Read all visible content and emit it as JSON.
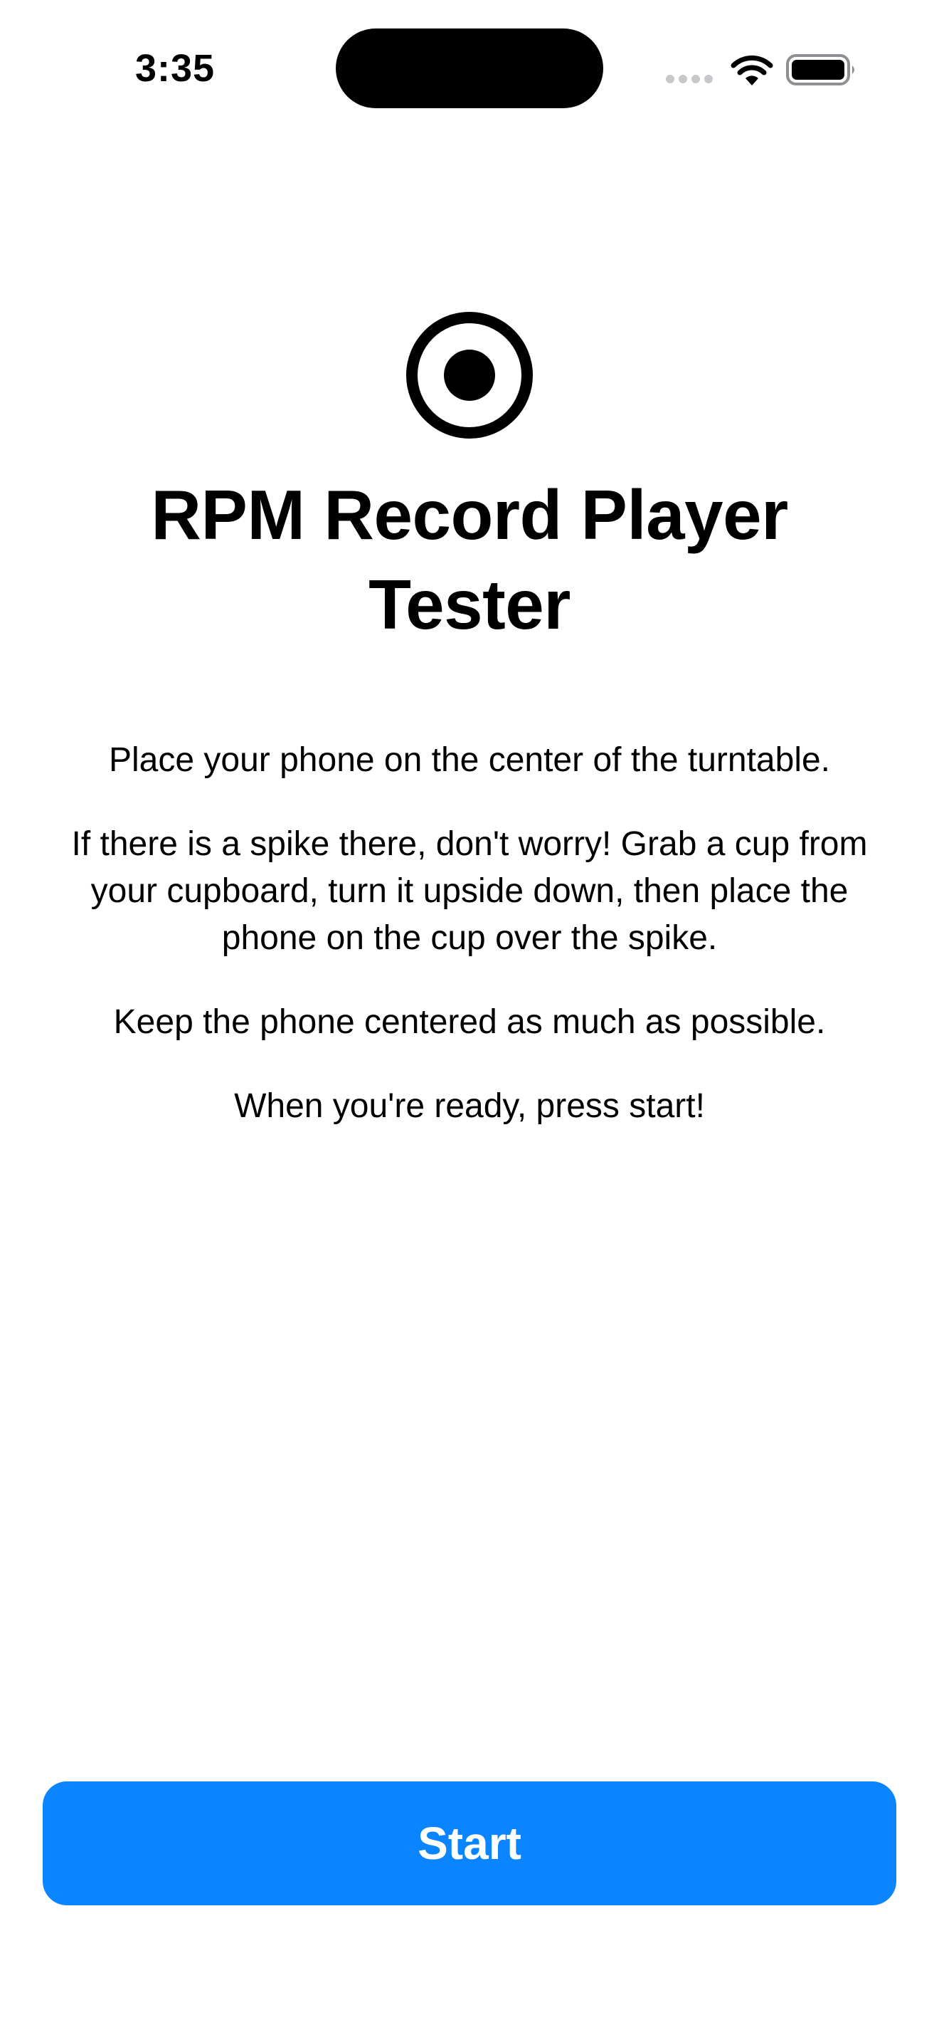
{
  "status_bar": {
    "time": "3:35",
    "icons": [
      "signal-dots-icon",
      "wifi-icon",
      "battery-icon"
    ]
  },
  "hero": {
    "icon": "record-circle-icon",
    "title": "RPM Record Player Tester"
  },
  "instructions": [
    "Place your phone on the center of the turntable.",
    "If there is a spike there, don't worry! Grab a cup from your cupboard, turn it upside down, then place the phone on the cup over the spike.",
    "Keep the phone centered as much as possible.",
    "When you're ready, press start!"
  ],
  "actions": {
    "start_label": "Start"
  },
  "colors": {
    "accent": "#0a84ff",
    "background": "#ffffff",
    "text": "#000000"
  }
}
